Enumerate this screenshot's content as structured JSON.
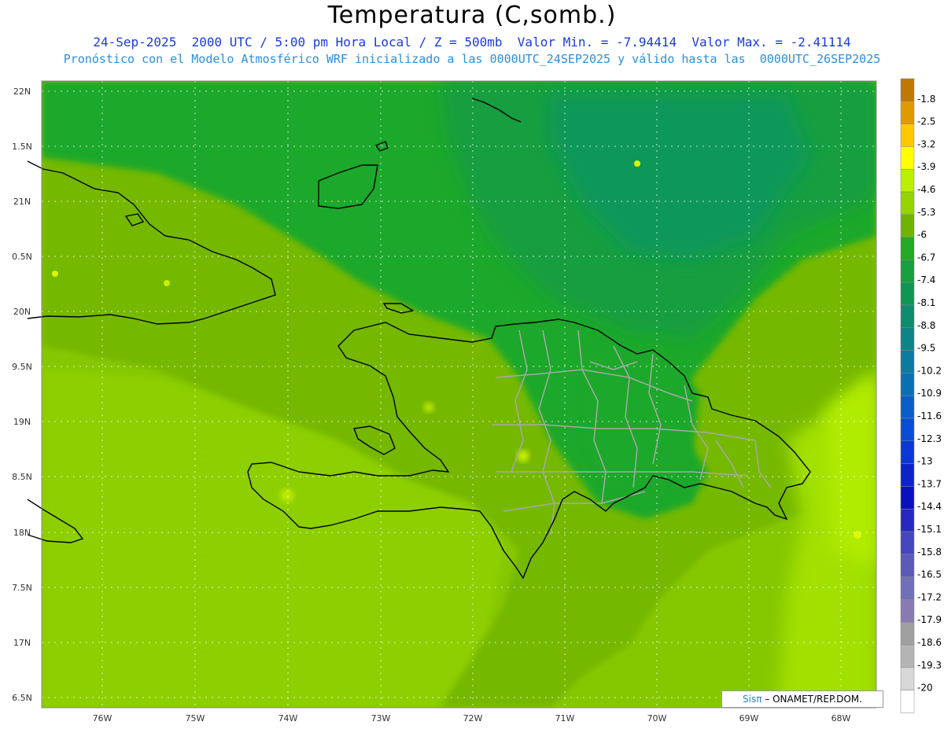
{
  "title": "Temperatura (C,somb.)",
  "subtitle_line1": "24-Sep-2025  2000 UTC / 5:00 pm Hora Local / Z = 500mb  Valor Min. = -7.94414  Valor Max. = -2.41114",
  "subtitle_line2": "Pronóstico con el Modelo Atmosférico WRF inicializado a las 0000UTC_24SEP2025 y válido hasta las  0000UTC_26SEP2025",
  "credit": {
    "brand": "Sisπ",
    "text": " – ONAMET/REP.DOM."
  },
  "colors": {
    "title": "#000000",
    "line1": "#1a3ae0",
    "line2": "#2a8fe0"
  },
  "lat_labels": [
    "22N",
    "1.5N",
    "21N",
    "0.5N",
    "20N",
    "9.5N",
    "19N",
    "8.5N",
    "18N",
    "7.5N",
    "17N",
    "6.5N"
  ],
  "lon_labels": [
    "76W",
    "75W",
    "74W",
    "73W",
    "72W",
    "71W",
    "70W",
    "69W",
    "68W"
  ],
  "colorbar": [
    {
      "label": "-1.8",
      "color": "#c07800"
    },
    {
      "label": "-2.5",
      "color": "#e09a00"
    },
    {
      "label": "-3.2",
      "color": "#ffc800"
    },
    {
      "label": "-3.9",
      "color": "#ffff00"
    },
    {
      "label": "-4.6",
      "color": "#b8f000"
    },
    {
      "label": "-5.3",
      "color": "#96d400"
    },
    {
      "label": "-6",
      "color": "#70b400"
    },
    {
      "label": "-6.7",
      "color": "#22aa22"
    },
    {
      "label": "-7.4",
      "color": "#16a040"
    },
    {
      "label": "-8.1",
      "color": "#109654"
    },
    {
      "label": "-8.8",
      "color": "#0e8c6e"
    },
    {
      "label": "-9.5",
      "color": "#0c8488"
    },
    {
      "label": "-10.2",
      "color": "#0a7ca0"
    },
    {
      "label": "-10.9",
      "color": "#0a70b4"
    },
    {
      "label": "-11.6",
      "color": "#0a5ec8"
    },
    {
      "label": "-12.3",
      "color": "#0a4cd4"
    },
    {
      "label": "-13",
      "color": "#0a38d4"
    },
    {
      "label": "-13.7",
      "color": "#0a24c8"
    },
    {
      "label": "-14.4",
      "color": "#0a10c0"
    },
    {
      "label": "-15.1",
      "color": "#2828c0"
    },
    {
      "label": "-15.8",
      "color": "#4646c0"
    },
    {
      "label": "-16.5",
      "color": "#5a5ab8"
    },
    {
      "label": "-17.2",
      "color": "#7070b8"
    },
    {
      "label": "-17.9",
      "color": "#8a7ab4"
    },
    {
      "label": "-18.6",
      "color": "#a0a0a0"
    },
    {
      "label": "-19.3",
      "color": "#b4b4b4"
    },
    {
      "label": "-20",
      "color": "#d8d8d8"
    },
    {
      "label": "",
      "color": "#ffffff"
    }
  ]
}
